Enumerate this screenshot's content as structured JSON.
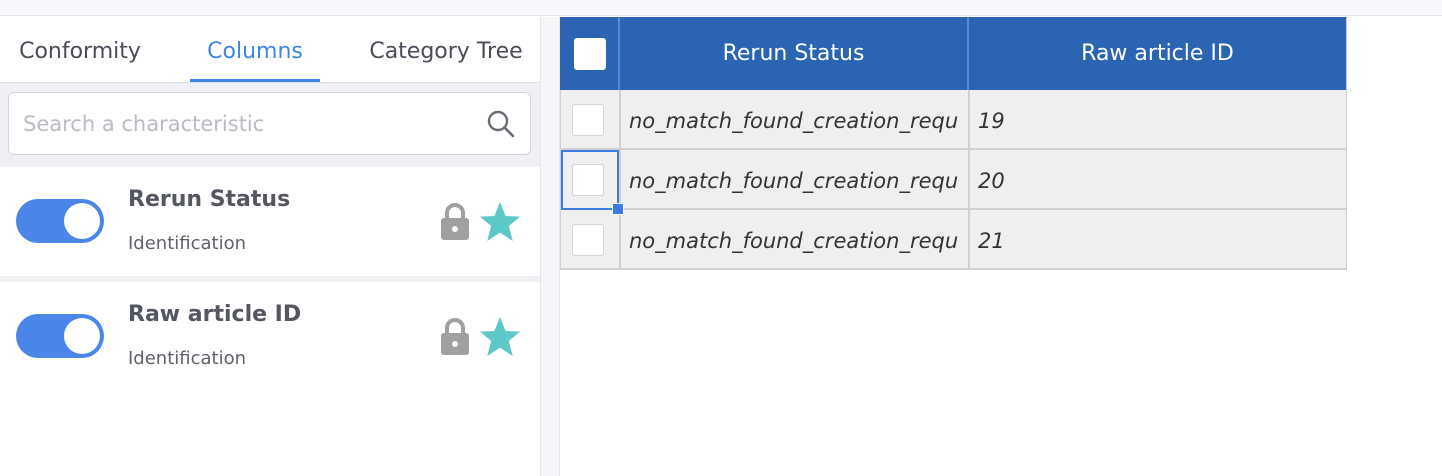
{
  "tabs": [
    {
      "label": "Conformity"
    },
    {
      "label": "Columns"
    },
    {
      "label": "Category Tree"
    }
  ],
  "active_tab": "Columns",
  "search": {
    "placeholder": "Search a characteristic",
    "value": ""
  },
  "columns": [
    {
      "title": "Rerun Status",
      "subtitle": "Identification",
      "enabled": true
    },
    {
      "title": "Raw article ID",
      "subtitle": "Identification",
      "enabled": true
    }
  ],
  "grid": {
    "headers": {
      "rerun_status": "Rerun Status",
      "raw_article_id": "Raw article ID"
    },
    "rows": [
      {
        "rerun_status": "no_match_found_creation_requ",
        "raw_article_id": "19"
      },
      {
        "rerun_status": "no_match_found_creation_requ",
        "raw_article_id": "20"
      },
      {
        "rerun_status": "no_match_found_creation_requ",
        "raw_article_id": "21"
      }
    ]
  },
  "colors": {
    "accent": "#3d86e3",
    "header_bg": "#2a64b2",
    "toggle_on": "#4a86e8",
    "star": "#5cc8c8",
    "lock": "#a0a0a0"
  },
  "icons": [
    "search-icon",
    "lock-icon",
    "star-icon"
  ]
}
